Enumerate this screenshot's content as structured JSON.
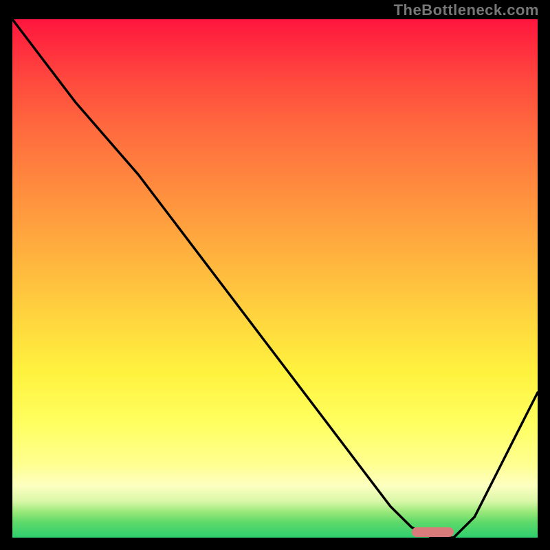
{
  "watermark": "TheBottleneck.com",
  "colors": {
    "background": "#000000",
    "curve_stroke": "#000000",
    "marker_fill": "#da7b7b",
    "gradient_top": "#ff163e",
    "gradient_bottom": "#2ecf6e"
  },
  "chart_data": {
    "type": "line",
    "title": "",
    "xlabel": "",
    "ylabel": "",
    "xlim": [
      0,
      100
    ],
    "ylim": [
      0,
      100
    ],
    "grid": false,
    "legend": false,
    "series": [
      {
        "name": "bottleneck-curve",
        "x": [
          0,
          6,
          12,
          18,
          24,
          30,
          36,
          42,
          48,
          54,
          60,
          66,
          72,
          76,
          80,
          84,
          88,
          92,
          96,
          100
        ],
        "y": [
          100,
          92,
          84,
          77,
          70,
          62,
          54,
          46,
          38,
          30,
          22,
          14,
          6,
          2,
          0,
          0,
          4,
          12,
          20,
          28
        ]
      }
    ],
    "annotations": [
      {
        "name": "optimal-range-marker",
        "type": "bar-segment",
        "x_start": 76,
        "x_end": 84,
        "y": 1
      }
    ]
  }
}
